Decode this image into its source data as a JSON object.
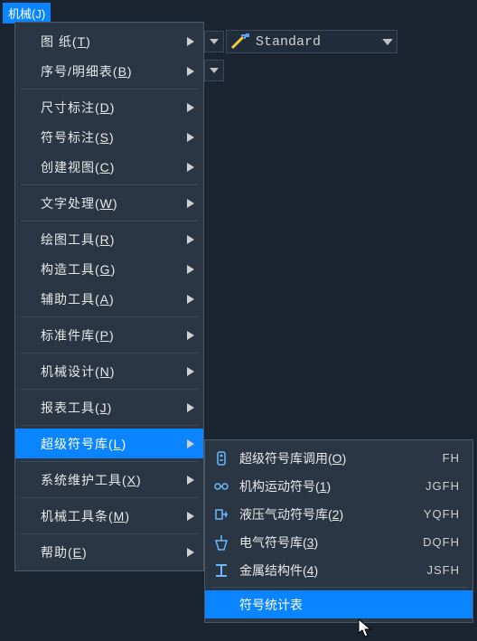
{
  "menuButton": "机械(J)",
  "dimStyle": "Standard",
  "mainMenu": [
    {
      "label": "图   纸",
      "hot": "T",
      "sep": false
    },
    {
      "label": "序号/明细表",
      "hot": "B",
      "sep": true
    },
    {
      "label": "尺寸标注",
      "hot": "D",
      "sep": false
    },
    {
      "label": "符号标注",
      "hot": "S",
      "sep": false
    },
    {
      "label": "创建视图",
      "hot": "C",
      "sep": true
    },
    {
      "label": "文字处理",
      "hot": "W",
      "sep": true
    },
    {
      "label": "绘图工具",
      "hot": "R",
      "sep": false
    },
    {
      "label": "构造工具",
      "hot": "G",
      "sep": false
    },
    {
      "label": "辅助工具",
      "hot": "A",
      "sep": true
    },
    {
      "label": "标准件库",
      "hot": "P",
      "sep": true
    },
    {
      "label": "机械设计",
      "hot": "N",
      "sep": true
    },
    {
      "label": "报表工具",
      "hot": "J",
      "sep": true
    },
    {
      "label": "超级符号库",
      "hot": "L",
      "sep": true,
      "hl": true
    },
    {
      "label": "系统维护工具",
      "hot": "X",
      "sep": true
    },
    {
      "label": "机械工具条",
      "hot": "M",
      "sep": true
    },
    {
      "label": "帮助",
      "hot": "E",
      "sep": false
    }
  ],
  "subMenu": [
    {
      "icon": "lib",
      "label": "超级符号库调用",
      "hot": "O",
      "shortcut": "FH"
    },
    {
      "icon": "mech",
      "label": "机构运动符号",
      "hot": "1",
      "shortcut": "JGFH"
    },
    {
      "icon": "hyd",
      "label": "液压气动符号库",
      "hot": "2",
      "shortcut": "YQFH"
    },
    {
      "icon": "elec",
      "label": "电气符号库",
      "hot": "3",
      "shortcut": "DQFH"
    },
    {
      "icon": "metal",
      "label": "金属结构件",
      "hot": "4",
      "shortcut": "JSFH"
    }
  ],
  "subLast": "符号统计表"
}
